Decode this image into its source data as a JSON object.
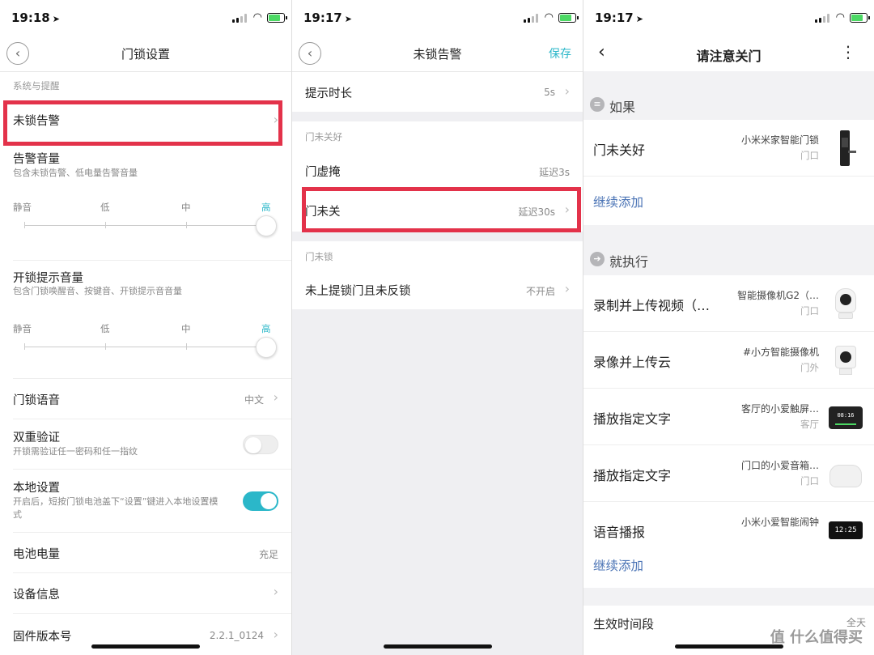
{
  "status": [
    {
      "time": "19:18"
    },
    {
      "time": "19:17"
    },
    {
      "time": "19:17"
    }
  ],
  "screen1": {
    "title": "门锁设置",
    "section": "系统与提醒",
    "unlock_alarm": "未锁告警",
    "alarm_volume": {
      "label": "告警音量",
      "sub": "包含未锁告警、低电量告警音量"
    },
    "volume_levels": [
      "静音",
      "低",
      "中",
      "高"
    ],
    "unlock_hint_volume": {
      "label": "开锁提示音量",
      "sub": "包含门锁唤醒音、按键音、开锁提示音音量"
    },
    "slider_level_fraction": 1.0,
    "lock_voice": {
      "label": "门锁语音",
      "value": "中文"
    },
    "dual_verify": {
      "label": "双重验证",
      "sub": "开锁需验证任一密码和任一指纹",
      "enabled": false
    },
    "local_settings": {
      "label": "本地设置",
      "sub": "开启后，短按门锁电池盖下“设置”键进入本地设置模式",
      "enabled": true
    },
    "battery": {
      "label": "电池电量",
      "value": "充足"
    },
    "device_info": {
      "label": "设备信息"
    },
    "firmware": {
      "label": "固件版本号",
      "value": "2.2.1_0124"
    }
  },
  "screen2": {
    "title": "未锁告警",
    "save": "保存",
    "prompt_duration": {
      "label": "提示时长",
      "value": "5s"
    },
    "section_door_not_closed": "门未关好",
    "door_ajar": {
      "label": "门虚掩",
      "value": "延迟3s"
    },
    "door_open": {
      "label": "门未关",
      "value": "延迟30s"
    },
    "section_door_unlocked": "门未锁",
    "not_deadbolted": {
      "label": "未上提锁门且未反锁",
      "value": "不开启"
    }
  },
  "screen3": {
    "title": "请注意关门",
    "if_header": "如果",
    "condition": {
      "name": "门未关好",
      "device": "小米米家智能门锁",
      "room": "门口"
    },
    "add_more": "继续添加",
    "then_header": "就执行",
    "actions": [
      {
        "name": "录制并上传视频（…",
        "device": "智能摄像机G2（…",
        "room": "门口",
        "thumb": "camera"
      },
      {
        "name": "录像并上传云",
        "device": "#小方智能摄像机",
        "room": "门外",
        "thumb": "square-camera"
      },
      {
        "name": "播放指定文字",
        "device": "客厅的小爱触屏…",
        "room": "客厅",
        "thumb": "touchscreen",
        "screen_text": "08:16"
      },
      {
        "name": "播放指定文字",
        "device": "门口的小爱音箱…",
        "room": "门口",
        "thumb": "speaker"
      },
      {
        "name": "语音播报",
        "device": "小米小爱智能闹钟",
        "room": "",
        "thumb": "clock",
        "screen_text": "12:25"
      }
    ],
    "add_more_2": "继续添加",
    "effective_period": {
      "label": "生效时间段",
      "value": "全天"
    },
    "watermark": "值 什么值得买"
  },
  "colors": {
    "accent": "#2bb7c9",
    "highlight": "#e3324a",
    "link": "#4a73b5"
  }
}
